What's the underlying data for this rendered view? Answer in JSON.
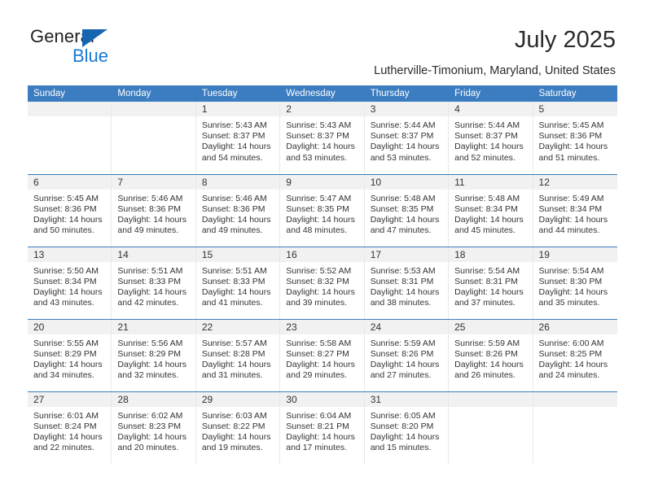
{
  "brand": {
    "name_top": "General",
    "name_bottom": "Blue"
  },
  "header": {
    "title": "July 2025",
    "subtitle": "Lutherville-Timonium, Maryland, United States"
  },
  "colors": {
    "header_blue": "#3b7dc0",
    "daynum_strip": "#f1f1f1",
    "logo_blue": "#1878cf",
    "text": "#333333"
  },
  "calendar": {
    "weekday_headers": [
      "Sunday",
      "Monday",
      "Tuesday",
      "Wednesday",
      "Thursday",
      "Friday",
      "Saturday"
    ],
    "labels": {
      "sunrise": "Sunrise:",
      "sunset": "Sunset:",
      "daylight": "Daylight:"
    },
    "weeks": [
      [
        {
          "day": "",
          "empty": true
        },
        {
          "day": "",
          "empty": true
        },
        {
          "day": "1",
          "sunrise": "Sunrise: 5:43 AM",
          "sunset": "Sunset: 8:37 PM",
          "daylight": "Daylight: 14 hours and 54 minutes."
        },
        {
          "day": "2",
          "sunrise": "Sunrise: 5:43 AM",
          "sunset": "Sunset: 8:37 PM",
          "daylight": "Daylight: 14 hours and 53 minutes."
        },
        {
          "day": "3",
          "sunrise": "Sunrise: 5:44 AM",
          "sunset": "Sunset: 8:37 PM",
          "daylight": "Daylight: 14 hours and 53 minutes."
        },
        {
          "day": "4",
          "sunrise": "Sunrise: 5:44 AM",
          "sunset": "Sunset: 8:37 PM",
          "daylight": "Daylight: 14 hours and 52 minutes."
        },
        {
          "day": "5",
          "sunrise": "Sunrise: 5:45 AM",
          "sunset": "Sunset: 8:36 PM",
          "daylight": "Daylight: 14 hours and 51 minutes."
        }
      ],
      [
        {
          "day": "6",
          "sunrise": "Sunrise: 5:45 AM",
          "sunset": "Sunset: 8:36 PM",
          "daylight": "Daylight: 14 hours and 50 minutes."
        },
        {
          "day": "7",
          "sunrise": "Sunrise: 5:46 AM",
          "sunset": "Sunset: 8:36 PM",
          "daylight": "Daylight: 14 hours and 49 minutes."
        },
        {
          "day": "8",
          "sunrise": "Sunrise: 5:46 AM",
          "sunset": "Sunset: 8:36 PM",
          "daylight": "Daylight: 14 hours and 49 minutes."
        },
        {
          "day": "9",
          "sunrise": "Sunrise: 5:47 AM",
          "sunset": "Sunset: 8:35 PM",
          "daylight": "Daylight: 14 hours and 48 minutes."
        },
        {
          "day": "10",
          "sunrise": "Sunrise: 5:48 AM",
          "sunset": "Sunset: 8:35 PM",
          "daylight": "Daylight: 14 hours and 47 minutes."
        },
        {
          "day": "11",
          "sunrise": "Sunrise: 5:48 AM",
          "sunset": "Sunset: 8:34 PM",
          "daylight": "Daylight: 14 hours and 45 minutes."
        },
        {
          "day": "12",
          "sunrise": "Sunrise: 5:49 AM",
          "sunset": "Sunset: 8:34 PM",
          "daylight": "Daylight: 14 hours and 44 minutes."
        }
      ],
      [
        {
          "day": "13",
          "sunrise": "Sunrise: 5:50 AM",
          "sunset": "Sunset: 8:34 PM",
          "daylight": "Daylight: 14 hours and 43 minutes."
        },
        {
          "day": "14",
          "sunrise": "Sunrise: 5:51 AM",
          "sunset": "Sunset: 8:33 PM",
          "daylight": "Daylight: 14 hours and 42 minutes."
        },
        {
          "day": "15",
          "sunrise": "Sunrise: 5:51 AM",
          "sunset": "Sunset: 8:33 PM",
          "daylight": "Daylight: 14 hours and 41 minutes."
        },
        {
          "day": "16",
          "sunrise": "Sunrise: 5:52 AM",
          "sunset": "Sunset: 8:32 PM",
          "daylight": "Daylight: 14 hours and 39 minutes."
        },
        {
          "day": "17",
          "sunrise": "Sunrise: 5:53 AM",
          "sunset": "Sunset: 8:31 PM",
          "daylight": "Daylight: 14 hours and 38 minutes."
        },
        {
          "day": "18",
          "sunrise": "Sunrise: 5:54 AM",
          "sunset": "Sunset: 8:31 PM",
          "daylight": "Daylight: 14 hours and 37 minutes."
        },
        {
          "day": "19",
          "sunrise": "Sunrise: 5:54 AM",
          "sunset": "Sunset: 8:30 PM",
          "daylight": "Daylight: 14 hours and 35 minutes."
        }
      ],
      [
        {
          "day": "20",
          "sunrise": "Sunrise: 5:55 AM",
          "sunset": "Sunset: 8:29 PM",
          "daylight": "Daylight: 14 hours and 34 minutes."
        },
        {
          "day": "21",
          "sunrise": "Sunrise: 5:56 AM",
          "sunset": "Sunset: 8:29 PM",
          "daylight": "Daylight: 14 hours and 32 minutes."
        },
        {
          "day": "22",
          "sunrise": "Sunrise: 5:57 AM",
          "sunset": "Sunset: 8:28 PM",
          "daylight": "Daylight: 14 hours and 31 minutes."
        },
        {
          "day": "23",
          "sunrise": "Sunrise: 5:58 AM",
          "sunset": "Sunset: 8:27 PM",
          "daylight": "Daylight: 14 hours and 29 minutes."
        },
        {
          "day": "24",
          "sunrise": "Sunrise: 5:59 AM",
          "sunset": "Sunset: 8:26 PM",
          "daylight": "Daylight: 14 hours and 27 minutes."
        },
        {
          "day": "25",
          "sunrise": "Sunrise: 5:59 AM",
          "sunset": "Sunset: 8:26 PM",
          "daylight": "Daylight: 14 hours and 26 minutes."
        },
        {
          "day": "26",
          "sunrise": "Sunrise: 6:00 AM",
          "sunset": "Sunset: 8:25 PM",
          "daylight": "Daylight: 14 hours and 24 minutes."
        }
      ],
      [
        {
          "day": "27",
          "sunrise": "Sunrise: 6:01 AM",
          "sunset": "Sunset: 8:24 PM",
          "daylight": "Daylight: 14 hours and 22 minutes."
        },
        {
          "day": "28",
          "sunrise": "Sunrise: 6:02 AM",
          "sunset": "Sunset: 8:23 PM",
          "daylight": "Daylight: 14 hours and 20 minutes."
        },
        {
          "day": "29",
          "sunrise": "Sunrise: 6:03 AM",
          "sunset": "Sunset: 8:22 PM",
          "daylight": "Daylight: 14 hours and 19 minutes."
        },
        {
          "day": "30",
          "sunrise": "Sunrise: 6:04 AM",
          "sunset": "Sunset: 8:21 PM",
          "daylight": "Daylight: 14 hours and 17 minutes."
        },
        {
          "day": "31",
          "sunrise": "Sunrise: 6:05 AM",
          "sunset": "Sunset: 8:20 PM",
          "daylight": "Daylight: 14 hours and 15 minutes."
        },
        {
          "day": "",
          "empty": true
        },
        {
          "day": "",
          "empty": true
        }
      ]
    ]
  }
}
